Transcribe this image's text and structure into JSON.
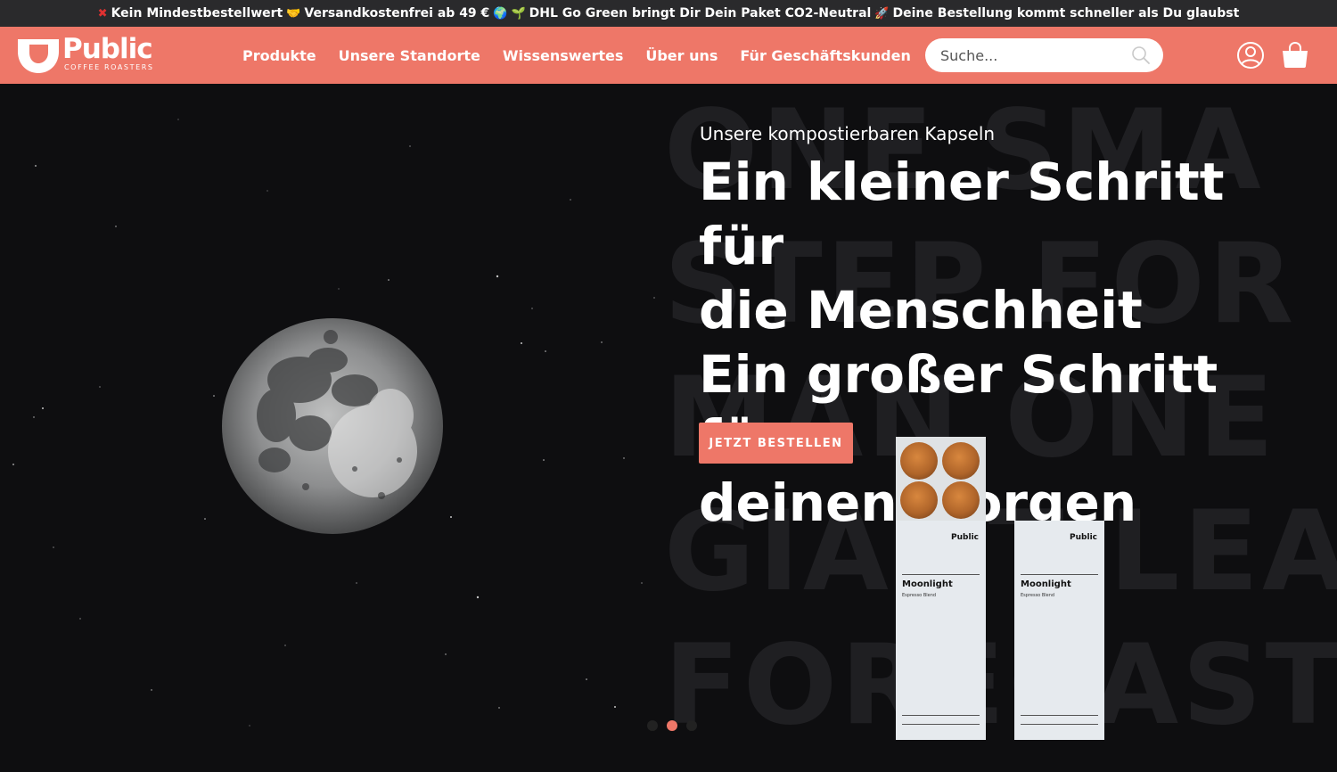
{
  "announcement": {
    "icon1": "cross-mark-emoji",
    "text1": "Kein Mindestbestellwert",
    "icon2": "handshake-emoji",
    "text2": "Versandkostenfrei ab 49 €",
    "icon3": "globe-seedling-emoji",
    "text3": "DHL Go Green bringt Dir Dein Paket CO2-Neutral",
    "icon4": "rocket-emoji",
    "text4": "Deine Bestellung kommt schneller als Du glaubst"
  },
  "header": {
    "logo_word": "Public",
    "logo_sub": "COFFEE ROASTERS",
    "nav": [
      "Produkte",
      "Unsere Standorte",
      "Wissenswertes",
      "Über uns",
      "Für Geschäftskunden"
    ],
    "search_placeholder": "Suche...",
    "icons": [
      "search-icon",
      "account-icon",
      "cart-icon"
    ]
  },
  "hero": {
    "eyebrow": "Unsere kompostierbaren Kapseln",
    "title_lines": [
      "Ein kleiner Schritt für",
      "die Menschheit",
      "Ein großer Schritt für",
      "deinen Morgen"
    ],
    "cta": "JETZT BESTELLEN",
    "background_words": [
      "ONE SMA",
      "STEP FOR",
      "MAN ONE",
      "GIANT LEA",
      "FORECAST"
    ],
    "product": {
      "brand": "Public",
      "name": "Moonlight",
      "subname": "Espresso Blend"
    },
    "carousel": {
      "count": 3,
      "active_index": 1
    }
  },
  "colors": {
    "accent": "#ee7768",
    "announcement_bg": "#2a2a2c",
    "hero_bg": "#0e0e10"
  }
}
